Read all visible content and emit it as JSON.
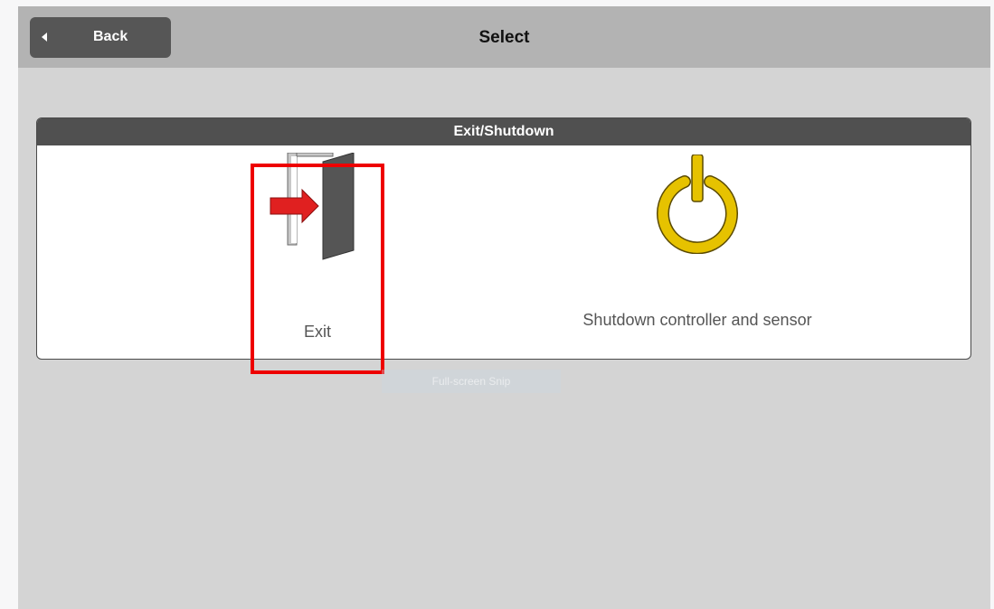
{
  "topbar": {
    "back_label": "Back",
    "title": "Select"
  },
  "panel": {
    "title": "Exit/Shutdown",
    "options": [
      {
        "label": "Exit",
        "icon": "exit-door-icon",
        "selected": true
      },
      {
        "label": "Shutdown controller and sensor",
        "icon": "power-icon",
        "selected": false
      }
    ]
  },
  "overlay": {
    "snip_label": "Full-screen Snip"
  },
  "colors": {
    "topbar": "#b3b3b3",
    "background": "#d4d4d4",
    "panel_header": "#505050",
    "selection": "#ee0000",
    "power_icon": "#e6c200",
    "arrow": "#e02020"
  }
}
